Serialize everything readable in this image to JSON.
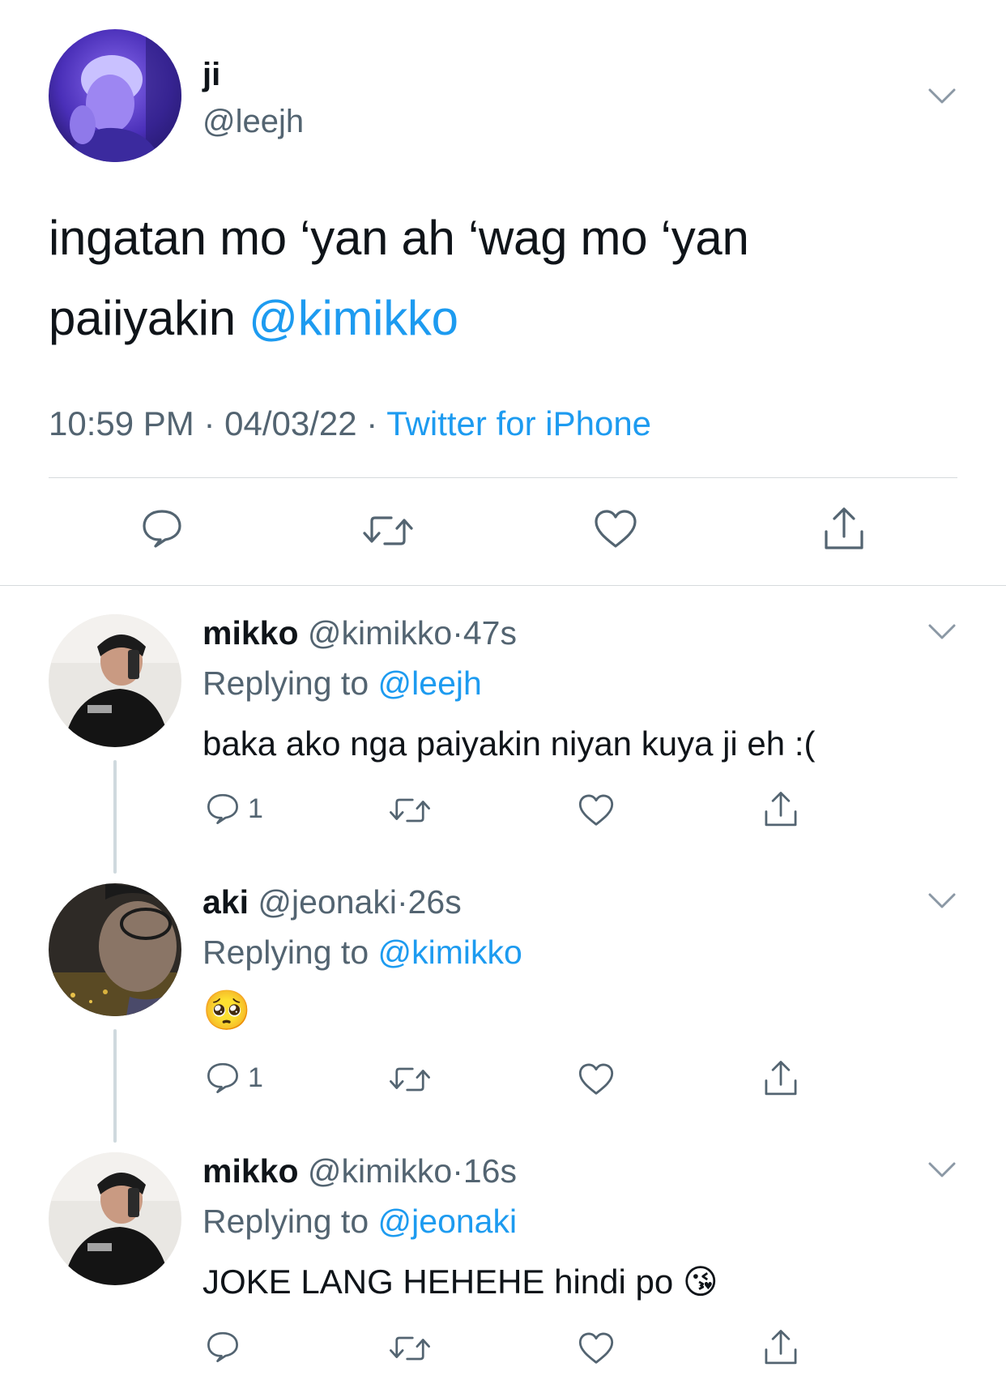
{
  "main_tweet": {
    "name": "ji",
    "handle": "@leejh",
    "text_line1": "ingatan mo ‘yan ah ‘wag mo ‘yan",
    "text_line2": "paiiyakin",
    "mention": "@kimikko",
    "time": "10:59 PM",
    "date": "04/03/22",
    "source": "Twitter for iPhone",
    "sep": "·"
  },
  "replies": [
    {
      "name": "mikko",
      "handle": "@kimikko",
      "sep": "·",
      "age": "47s",
      "replying_label": "Replying to",
      "replying_to": "@leejh",
      "text": "baka ako nga paiyakin niyan kuya ji eh :(",
      "reply_count": "1"
    },
    {
      "name": "aki",
      "handle": "@jeonaki",
      "sep": "·",
      "age": "26s",
      "replying_label": "Replying to",
      "replying_to": "@kimikko",
      "text": "🥺",
      "reply_count": "1"
    },
    {
      "name": "mikko",
      "handle": "@kimikko",
      "sep": "·",
      "age": "16s",
      "replying_label": "Replying to",
      "replying_to": "@jeonaki",
      "text": "JOKE LANG HEHEHE hindi po 😘",
      "reply_count": ""
    }
  ],
  "icons": {
    "reply": "reply-icon",
    "retweet": "retweet-icon",
    "like": "heart-icon",
    "share": "share-icon",
    "more": "chevron-down-icon"
  },
  "colors": {
    "link": "#1d9bf0",
    "secondary": "#536471",
    "divider": "#d6dadd"
  }
}
